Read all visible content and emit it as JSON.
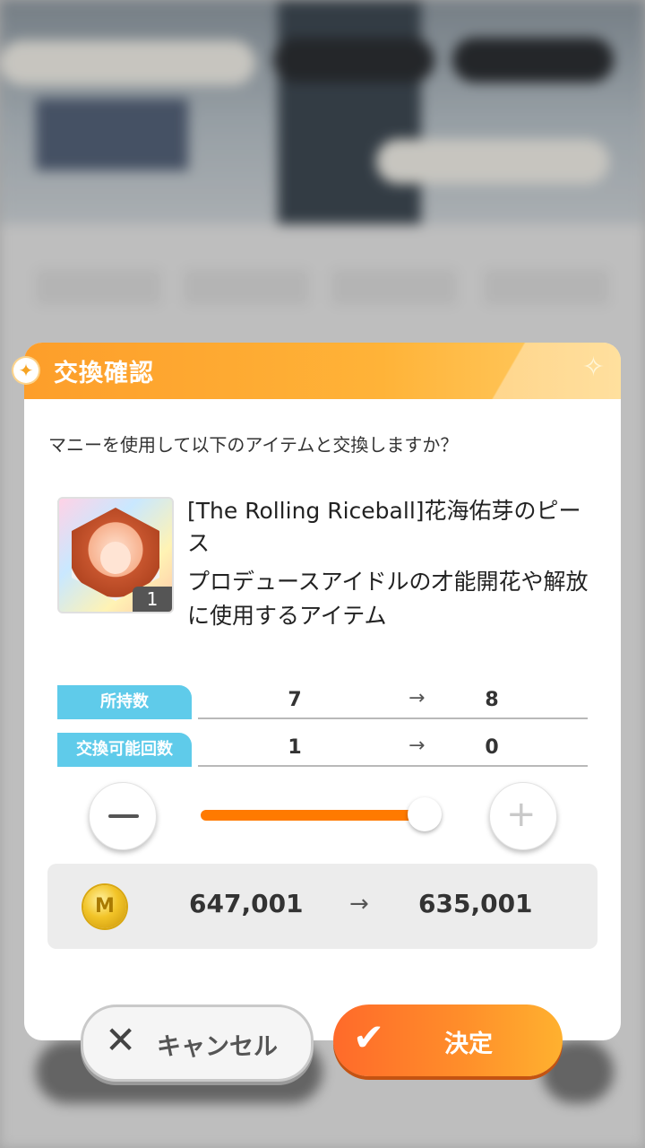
{
  "dialog": {
    "title": "交換確認",
    "question": "マニーを使用して以下のアイテムと交換しますか？",
    "item": {
      "name": "[The Rolling Riceball]花海佑芽のピース",
      "description": "プロデュースアイドルの才能開花や解放に使用するアイテム",
      "quantity": "1"
    },
    "rows": [
      {
        "label": "所持数",
        "from": "7",
        "to": "8"
      },
      {
        "label": "交換可能回数",
        "from": "1",
        "to": "0"
      }
    ],
    "slider": {
      "value": 1,
      "max": 1
    },
    "cost": {
      "from": "647,001",
      "to": "635,001"
    },
    "buttons": {
      "cancel": "キャンセル",
      "confirm": "決定"
    }
  },
  "icons": {
    "arrow": "→",
    "cancel": "✕",
    "confirm": "✔",
    "plus": "+",
    "sparkle": "✦",
    "sparkle_right": "✧",
    "coin": "M"
  },
  "colors": {
    "header": "#ffb338",
    "label_bg": "#5fcbea",
    "slider": "#ff7a00",
    "confirm_button": "#ff8d2a"
  }
}
